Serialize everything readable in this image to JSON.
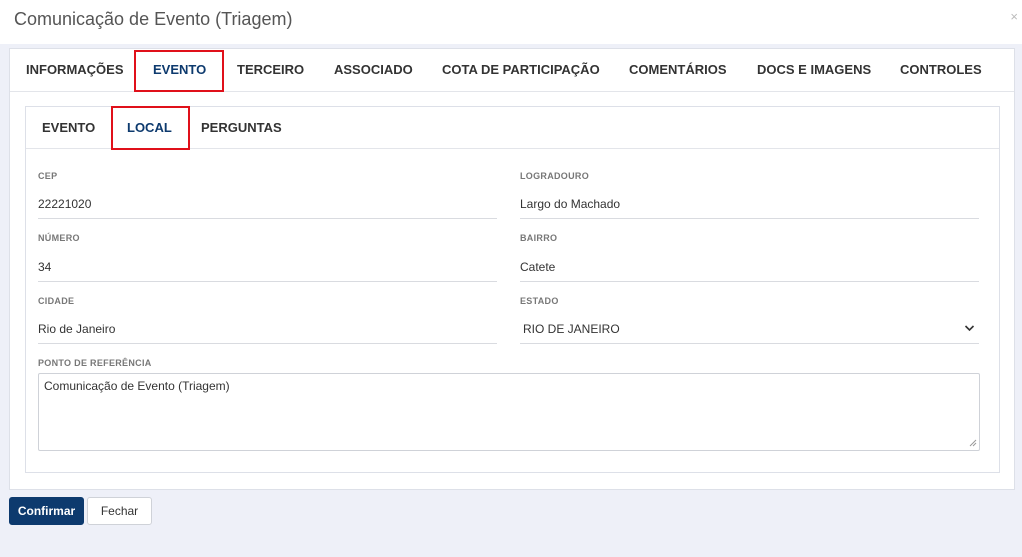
{
  "modal": {
    "title": "Comunicação de Evento (Triagem)",
    "close_label": "×"
  },
  "main_tabs": [
    {
      "label": "INFORMAÇÕES"
    },
    {
      "label": "EVENTO",
      "active": true
    },
    {
      "label": "TERCEIRO"
    },
    {
      "label": "ASSOCIADO"
    },
    {
      "label": "COTA DE PARTICIPAÇÃO"
    },
    {
      "label": "COMENTÁRIOS"
    },
    {
      "label": "DOCS E IMAGENS"
    },
    {
      "label": "CONTROLES"
    }
  ],
  "sub_tabs": [
    {
      "label": "EVENTO"
    },
    {
      "label": "LOCAL",
      "active": true
    },
    {
      "label": "PERGUNTAS"
    }
  ],
  "form": {
    "cep": {
      "label": "CEP",
      "value": "22221020"
    },
    "logradouro": {
      "label": "LOGRADOURO",
      "value": "Largo do Machado"
    },
    "numero": {
      "label": "NÚMERO",
      "value": "34"
    },
    "bairro": {
      "label": "BAIRRO",
      "value": "Catete"
    },
    "cidade": {
      "label": "CIDADE",
      "value": "Rio de Janeiro"
    },
    "estado": {
      "label": "ESTADO",
      "value": "RIO DE JANEIRO"
    },
    "referencia": {
      "label": "PONTO DE REFERÊNCIA",
      "value": "Comunicação de Evento (Triagem)"
    }
  },
  "buttons": {
    "confirm": "Confirmar",
    "close": "Fechar"
  },
  "colors": {
    "primary": "#0d3a6e",
    "highlight": "#e0101a",
    "background": "#eef0f8"
  }
}
